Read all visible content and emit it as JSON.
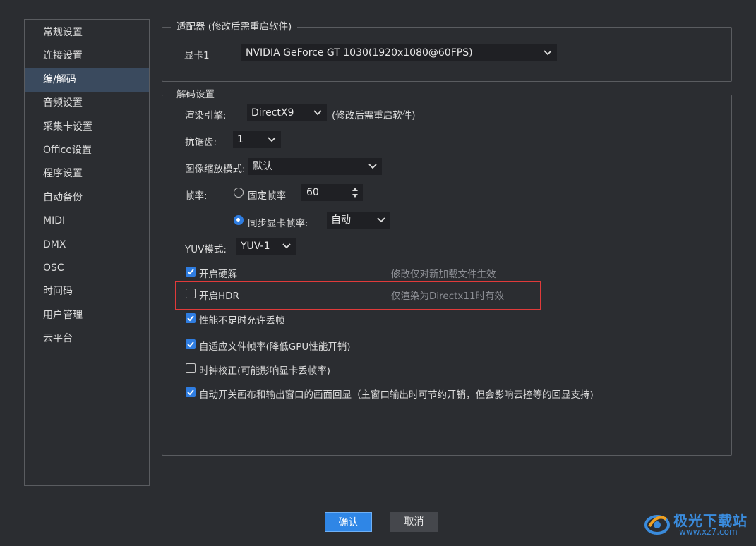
{
  "sidebar": {
    "items": [
      {
        "label": "常规设置",
        "active": false
      },
      {
        "label": "连接设置",
        "active": false
      },
      {
        "label": "编/解码",
        "active": true
      },
      {
        "label": "音频设置",
        "active": false
      },
      {
        "label": "采集卡设置",
        "active": false
      },
      {
        "label": "Office设置",
        "active": false
      },
      {
        "label": "程序设置",
        "active": false
      },
      {
        "label": "自动备份",
        "active": false
      },
      {
        "label": "MIDI",
        "active": false
      },
      {
        "label": "DMX",
        "active": false
      },
      {
        "label": "OSC",
        "active": false
      },
      {
        "label": "时间码",
        "active": false
      },
      {
        "label": "用户管理",
        "active": false
      },
      {
        "label": "云平台",
        "active": false
      }
    ]
  },
  "adapter": {
    "legend": "适配器 (修改后需重启软件)",
    "gpu_label": "显卡1",
    "gpu_value": "NVIDIA GeForce GT 1030(1920x1080@60FPS)"
  },
  "decode": {
    "legend": "解码设置",
    "render_engine_label": "渲染引擎:",
    "render_engine_value": "DirectX9",
    "render_engine_note": "(修改后需重启软件)",
    "antialias_label": "抗锯齿:",
    "antialias_value": "1",
    "scale_mode_label": "图像缩放模式:",
    "scale_mode_value": "默认",
    "framerate_label": "帧率:",
    "fixed_rate_label": "固定帧率",
    "fixed_rate_value": "60",
    "fixed_rate_selected": false,
    "sync_rate_label": "同步显卡帧率:",
    "sync_rate_value": "自动",
    "sync_rate_selected": true,
    "yuv_label": "YUV模式:",
    "yuv_value": "YUV-1",
    "options": [
      {
        "label": "开启硬解",
        "checked": true,
        "hint": "修改仅对新加载文件生效"
      },
      {
        "label": "开启HDR",
        "checked": false,
        "hint": "仅渲染为Directx11时有效"
      },
      {
        "label": "性能不足时允许丢帧",
        "checked": true,
        "hint": ""
      },
      {
        "label": "自适应文件帧率(降低GPU性能开销)",
        "checked": true,
        "hint": ""
      },
      {
        "label": "时钟校正(可能影响显卡丢帧率)",
        "checked": false,
        "hint": ""
      },
      {
        "label": "自动开关画布和输出窗口的画面回显（主窗口输出时可节约开销，但会影响云控等的回显支持)",
        "checked": true,
        "hint": ""
      }
    ]
  },
  "footer": {
    "ok_label": "确认",
    "cancel_label": "取消"
  },
  "watermark": {
    "text": "极光下载站",
    "url": "www.xz7.com"
  },
  "colors": {
    "background": "#2b2d31",
    "accent": "#2f7de1",
    "highlight": "#e03a3a",
    "active_item": "#3a4a5e"
  }
}
